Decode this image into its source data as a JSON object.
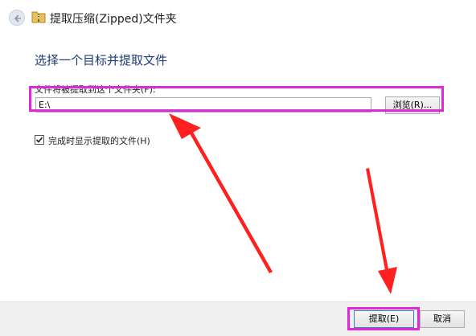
{
  "window": {
    "title": "提取压缩(Zipped)文件夹",
    "back_icon": "back-arrow-icon",
    "folder_icon": "zip-folder-icon"
  },
  "main": {
    "heading": "选择一个目标并提取文件",
    "destination_label": "文件将被提取到这个文件夹(F):",
    "destination_value": "E:\\",
    "browse_label": "浏览(R)...",
    "show_files_checked": true,
    "show_files_label": "完成时显示提取的文件(H)"
  },
  "footer": {
    "extract_label": "提取(E)",
    "cancel_label": "取消"
  },
  "colors": {
    "highlight": "#e028d8",
    "arrow": "#ff2020",
    "heading": "#1e3b78"
  }
}
